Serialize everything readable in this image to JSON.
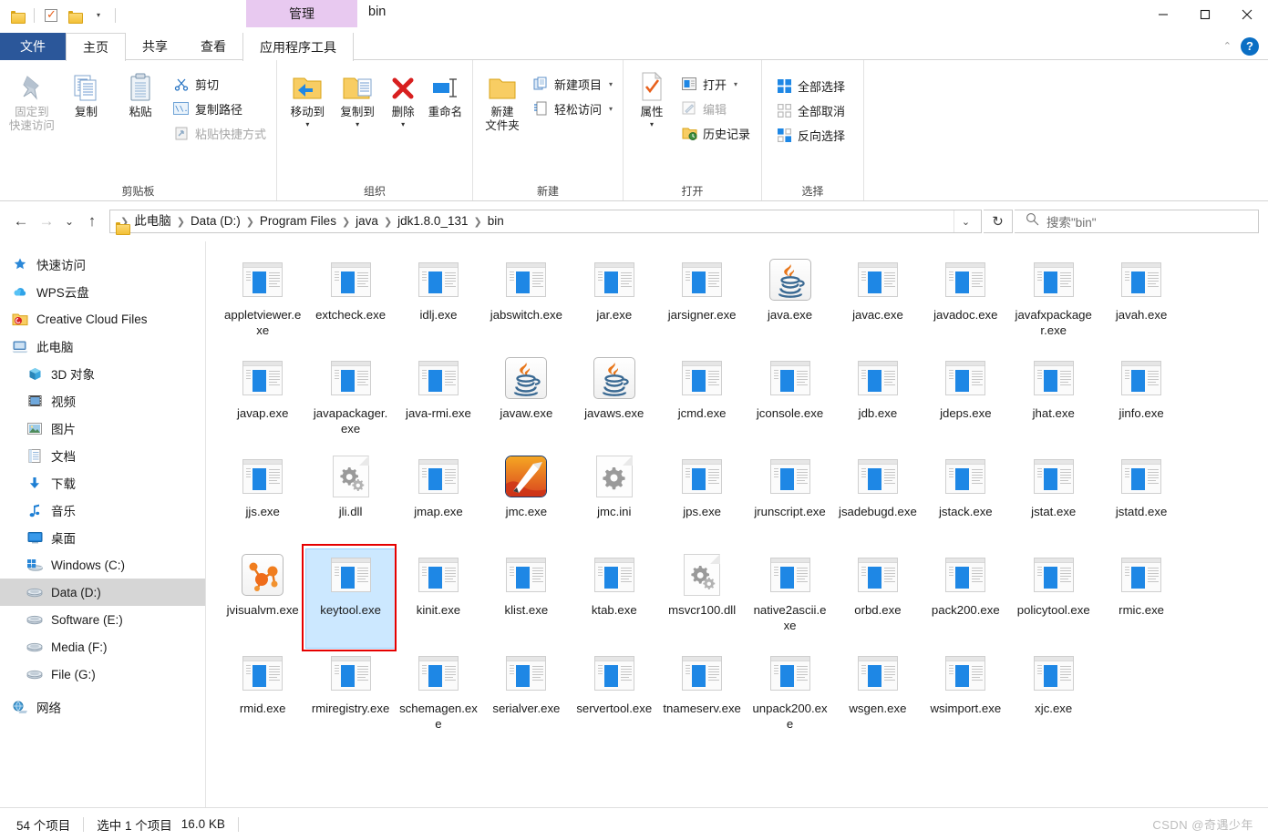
{
  "titlebar": {
    "quick_access": [
      {
        "name": "folder-icon",
        "label": ""
      },
      {
        "name": "properties-check-icon",
        "label": ""
      },
      {
        "name": "new-folder-icon",
        "label": ""
      },
      {
        "name": "customize-dropdown-icon",
        "label": "▾"
      }
    ],
    "context_tab_group": "管理",
    "window_title": "bin",
    "controls": {
      "minimize": "minimize-icon",
      "maximize": "maximize-icon",
      "close": "close-icon"
    }
  },
  "tabs": [
    {
      "label": "文件",
      "name": "tab-file"
    },
    {
      "label": "主页",
      "name": "tab-home"
    },
    {
      "label": "共享",
      "name": "tab-share"
    },
    {
      "label": "查看",
      "name": "tab-view"
    },
    {
      "label": "应用程序工具",
      "name": "tab-application-tools"
    }
  ],
  "tabstrip_right": {
    "collapse": "⌃",
    "help": "?"
  },
  "ribbon": {
    "groups": [
      {
        "label": "剪贴板",
        "big_buttons": [
          {
            "label_line1": "固定到",
            "label_line2": "快速访问",
            "icon": "pin-icon",
            "disabled": true
          },
          {
            "label_line1": "复制",
            "label_line2": "",
            "icon": "copy-icon",
            "disabled": false
          },
          {
            "label_line1": "粘贴",
            "label_line2": "",
            "icon": "paste-icon",
            "disabled": false
          }
        ],
        "small_buttons": [
          {
            "label": "剪切",
            "icon": "scissors-icon",
            "disabled": false
          },
          {
            "label": "复制路径",
            "icon": "copy-path-icon",
            "disabled": false
          },
          {
            "label": "粘贴快捷方式",
            "icon": "paste-shortcut-icon",
            "disabled": true
          }
        ]
      },
      {
        "label": "组织",
        "big_buttons": [
          {
            "label_line1": "移动到",
            "label_line2": "",
            "icon": "move-to-icon",
            "dropdown": true
          },
          {
            "label_line1": "复制到",
            "label_line2": "",
            "icon": "copy-to-icon",
            "dropdown": true
          },
          {
            "label_line1": "删除",
            "label_line2": "",
            "icon": "delete-icon",
            "dropdown": true
          },
          {
            "label_line1": "重命名",
            "label_line2": "",
            "icon": "rename-icon",
            "dropdown": false
          }
        ],
        "small_buttons": []
      },
      {
        "label": "新建",
        "big_buttons": [
          {
            "label_line1": "新建",
            "label_line2": "文件夹",
            "icon": "new-folder-icon",
            "dropdown": false
          }
        ],
        "small_buttons": [
          {
            "label": "新建项目",
            "icon": "new-item-icon",
            "dropdown": true
          },
          {
            "label": "轻松访问",
            "icon": "easy-access-icon",
            "dropdown": true
          }
        ]
      },
      {
        "label": "打开",
        "big_buttons": [
          {
            "label_line1": "属性",
            "label_line2": "",
            "icon": "properties-icon",
            "dropdown": true
          }
        ],
        "small_buttons": [
          {
            "label": "打开",
            "icon": "open-icon",
            "dropdown": true
          },
          {
            "label": "编辑",
            "icon": "edit-icon",
            "disabled": true
          },
          {
            "label": "历史记录",
            "icon": "history-icon"
          }
        ]
      },
      {
        "label": "选择",
        "big_buttons": [],
        "small_buttons": [
          {
            "label": "全部选择",
            "icon": "select-all-icon"
          },
          {
            "label": "全部取消",
            "icon": "select-none-icon"
          },
          {
            "label": "反向选择",
            "icon": "invert-selection-icon"
          }
        ]
      }
    ]
  },
  "address": {
    "back": "←",
    "forward": "→",
    "recent": "⌄",
    "up": "↑",
    "breadcrumbs": [
      "此电脑",
      "Data (D:)",
      "Program Files",
      "java",
      "jdk1.8.0_131",
      "bin"
    ],
    "dropdown": "⌄",
    "refresh": "↻"
  },
  "search": {
    "placeholder": "搜索\"bin\"",
    "icon": "search-icon"
  },
  "sidebar": {
    "items": [
      {
        "label": "快速访问",
        "icon": "star-pin-icon",
        "level": 1,
        "selected": false
      },
      {
        "label": "WPS云盘",
        "icon": "cloud-icon",
        "level": 1,
        "selected": false
      },
      {
        "label": "Creative Cloud Files",
        "icon": "creative-cloud-folder-icon",
        "level": 1,
        "selected": false
      },
      {
        "label": "此电脑",
        "icon": "this-pc-icon",
        "level": 1,
        "selected": false
      },
      {
        "label": "3D 对象",
        "icon": "3d-objects-icon",
        "level": 2,
        "selected": false
      },
      {
        "label": "视频",
        "icon": "videos-icon",
        "level": 2,
        "selected": false
      },
      {
        "label": "图片",
        "icon": "pictures-icon",
        "level": 2,
        "selected": false
      },
      {
        "label": "文档",
        "icon": "documents-icon",
        "level": 2,
        "selected": false
      },
      {
        "label": "下载",
        "icon": "downloads-icon",
        "level": 2,
        "selected": false
      },
      {
        "label": "音乐",
        "icon": "music-icon",
        "level": 2,
        "selected": false
      },
      {
        "label": "桌面",
        "icon": "desktop-icon",
        "level": 2,
        "selected": false
      },
      {
        "label": "Windows (C:)",
        "icon": "windows-drive-icon",
        "level": 2,
        "selected": false
      },
      {
        "label": "Data (D:)",
        "icon": "drive-icon",
        "level": 2,
        "selected": true
      },
      {
        "label": "Software (E:)",
        "icon": "drive-icon",
        "level": 2,
        "selected": false
      },
      {
        "label": "Media (F:)",
        "icon": "drive-icon",
        "level": 2,
        "selected": false
      },
      {
        "label": "File (G:)",
        "icon": "drive-icon",
        "level": 2,
        "selected": false
      },
      {
        "label": "网络",
        "icon": "network-icon",
        "level": 1,
        "selected": false
      }
    ]
  },
  "files": [
    {
      "name": "appletviewer.exe",
      "icon": "exe-icon",
      "selected": false
    },
    {
      "name": "extcheck.exe",
      "icon": "exe-icon",
      "selected": false
    },
    {
      "name": "idlj.exe",
      "icon": "exe-icon",
      "selected": false
    },
    {
      "name": "jabswitch.exe",
      "icon": "exe-icon",
      "selected": false
    },
    {
      "name": "jar.exe",
      "icon": "exe-icon",
      "selected": false
    },
    {
      "name": "jarsigner.exe",
      "icon": "exe-icon",
      "selected": false
    },
    {
      "name": "java.exe",
      "icon": "java-icon",
      "selected": false
    },
    {
      "name": "javac.exe",
      "icon": "exe-icon",
      "selected": false
    },
    {
      "name": "javadoc.exe",
      "icon": "exe-icon",
      "selected": false
    },
    {
      "name": "javafxpackager.exe",
      "icon": "exe-icon",
      "selected": false
    },
    {
      "name": "javah.exe",
      "icon": "exe-icon",
      "selected": false
    },
    {
      "name": "javap.exe",
      "icon": "exe-icon",
      "selected": false
    },
    {
      "name": "javapackager.exe",
      "icon": "exe-icon",
      "selected": false
    },
    {
      "name": "java-rmi.exe",
      "icon": "exe-icon",
      "selected": false
    },
    {
      "name": "javaw.exe",
      "icon": "java-icon",
      "selected": false
    },
    {
      "name": "javaws.exe",
      "icon": "java-icon",
      "selected": false
    },
    {
      "name": "jcmd.exe",
      "icon": "exe-icon",
      "selected": false
    },
    {
      "name": "jconsole.exe",
      "icon": "exe-icon",
      "selected": false
    },
    {
      "name": "jdb.exe",
      "icon": "exe-icon",
      "selected": false
    },
    {
      "name": "jdeps.exe",
      "icon": "exe-icon",
      "selected": false
    },
    {
      "name": "jhat.exe",
      "icon": "exe-icon",
      "selected": false
    },
    {
      "name": "jinfo.exe",
      "icon": "exe-icon",
      "selected": false
    },
    {
      "name": "jjs.exe",
      "icon": "exe-icon",
      "selected": false
    },
    {
      "name": "jli.dll",
      "icon": "dll-icon",
      "selected": false
    },
    {
      "name": "jmap.exe",
      "icon": "exe-icon",
      "selected": false
    },
    {
      "name": "jmc.exe",
      "icon": "rocket-icon",
      "selected": false
    },
    {
      "name": "jmc.ini",
      "icon": "ini-icon",
      "selected": false
    },
    {
      "name": "jps.exe",
      "icon": "exe-icon",
      "selected": false
    },
    {
      "name": "jrunscript.exe",
      "icon": "exe-icon",
      "selected": false
    },
    {
      "name": "jsadebugd.exe",
      "icon": "exe-icon",
      "selected": false
    },
    {
      "name": "jstack.exe",
      "icon": "exe-icon",
      "selected": false
    },
    {
      "name": "jstat.exe",
      "icon": "exe-icon",
      "selected": false
    },
    {
      "name": "jstatd.exe",
      "icon": "exe-icon",
      "selected": false
    },
    {
      "name": "jvisualvm.exe",
      "icon": "visualvm-icon",
      "selected": false
    },
    {
      "name": "keytool.exe",
      "icon": "exe-icon",
      "selected": true,
      "annotated": true
    },
    {
      "name": "kinit.exe",
      "icon": "exe-icon",
      "selected": false
    },
    {
      "name": "klist.exe",
      "icon": "exe-icon",
      "selected": false
    },
    {
      "name": "ktab.exe",
      "icon": "exe-icon",
      "selected": false
    },
    {
      "name": "msvcr100.dll",
      "icon": "dll-icon",
      "selected": false
    },
    {
      "name": "native2ascii.exe",
      "icon": "exe-icon",
      "selected": false
    },
    {
      "name": "orbd.exe",
      "icon": "exe-icon",
      "selected": false
    },
    {
      "name": "pack200.exe",
      "icon": "exe-icon",
      "selected": false
    },
    {
      "name": "policytool.exe",
      "icon": "exe-icon",
      "selected": false
    },
    {
      "name": "rmic.exe",
      "icon": "exe-icon",
      "selected": false
    },
    {
      "name": "rmid.exe",
      "icon": "exe-icon",
      "selected": false
    },
    {
      "name": "rmiregistry.exe",
      "icon": "exe-icon",
      "selected": false
    },
    {
      "name": "schemagen.exe",
      "icon": "exe-icon",
      "selected": false
    },
    {
      "name": "serialver.exe",
      "icon": "exe-icon",
      "selected": false
    },
    {
      "name": "servertool.exe",
      "icon": "exe-icon",
      "selected": false
    },
    {
      "name": "tnameserv.exe",
      "icon": "exe-icon",
      "selected": false
    },
    {
      "name": "unpack200.exe",
      "icon": "exe-icon",
      "selected": false
    },
    {
      "name": "wsgen.exe",
      "icon": "exe-icon",
      "selected": false
    },
    {
      "name": "wsimport.exe",
      "icon": "exe-icon",
      "selected": false
    },
    {
      "name": "xjc.exe",
      "icon": "exe-icon",
      "selected": false
    }
  ],
  "statusbar": {
    "item_count": "54 个项目",
    "selection": "选中 1 个项目",
    "size": "16.0 KB"
  },
  "watermark": "CSDN @奇遇少年"
}
